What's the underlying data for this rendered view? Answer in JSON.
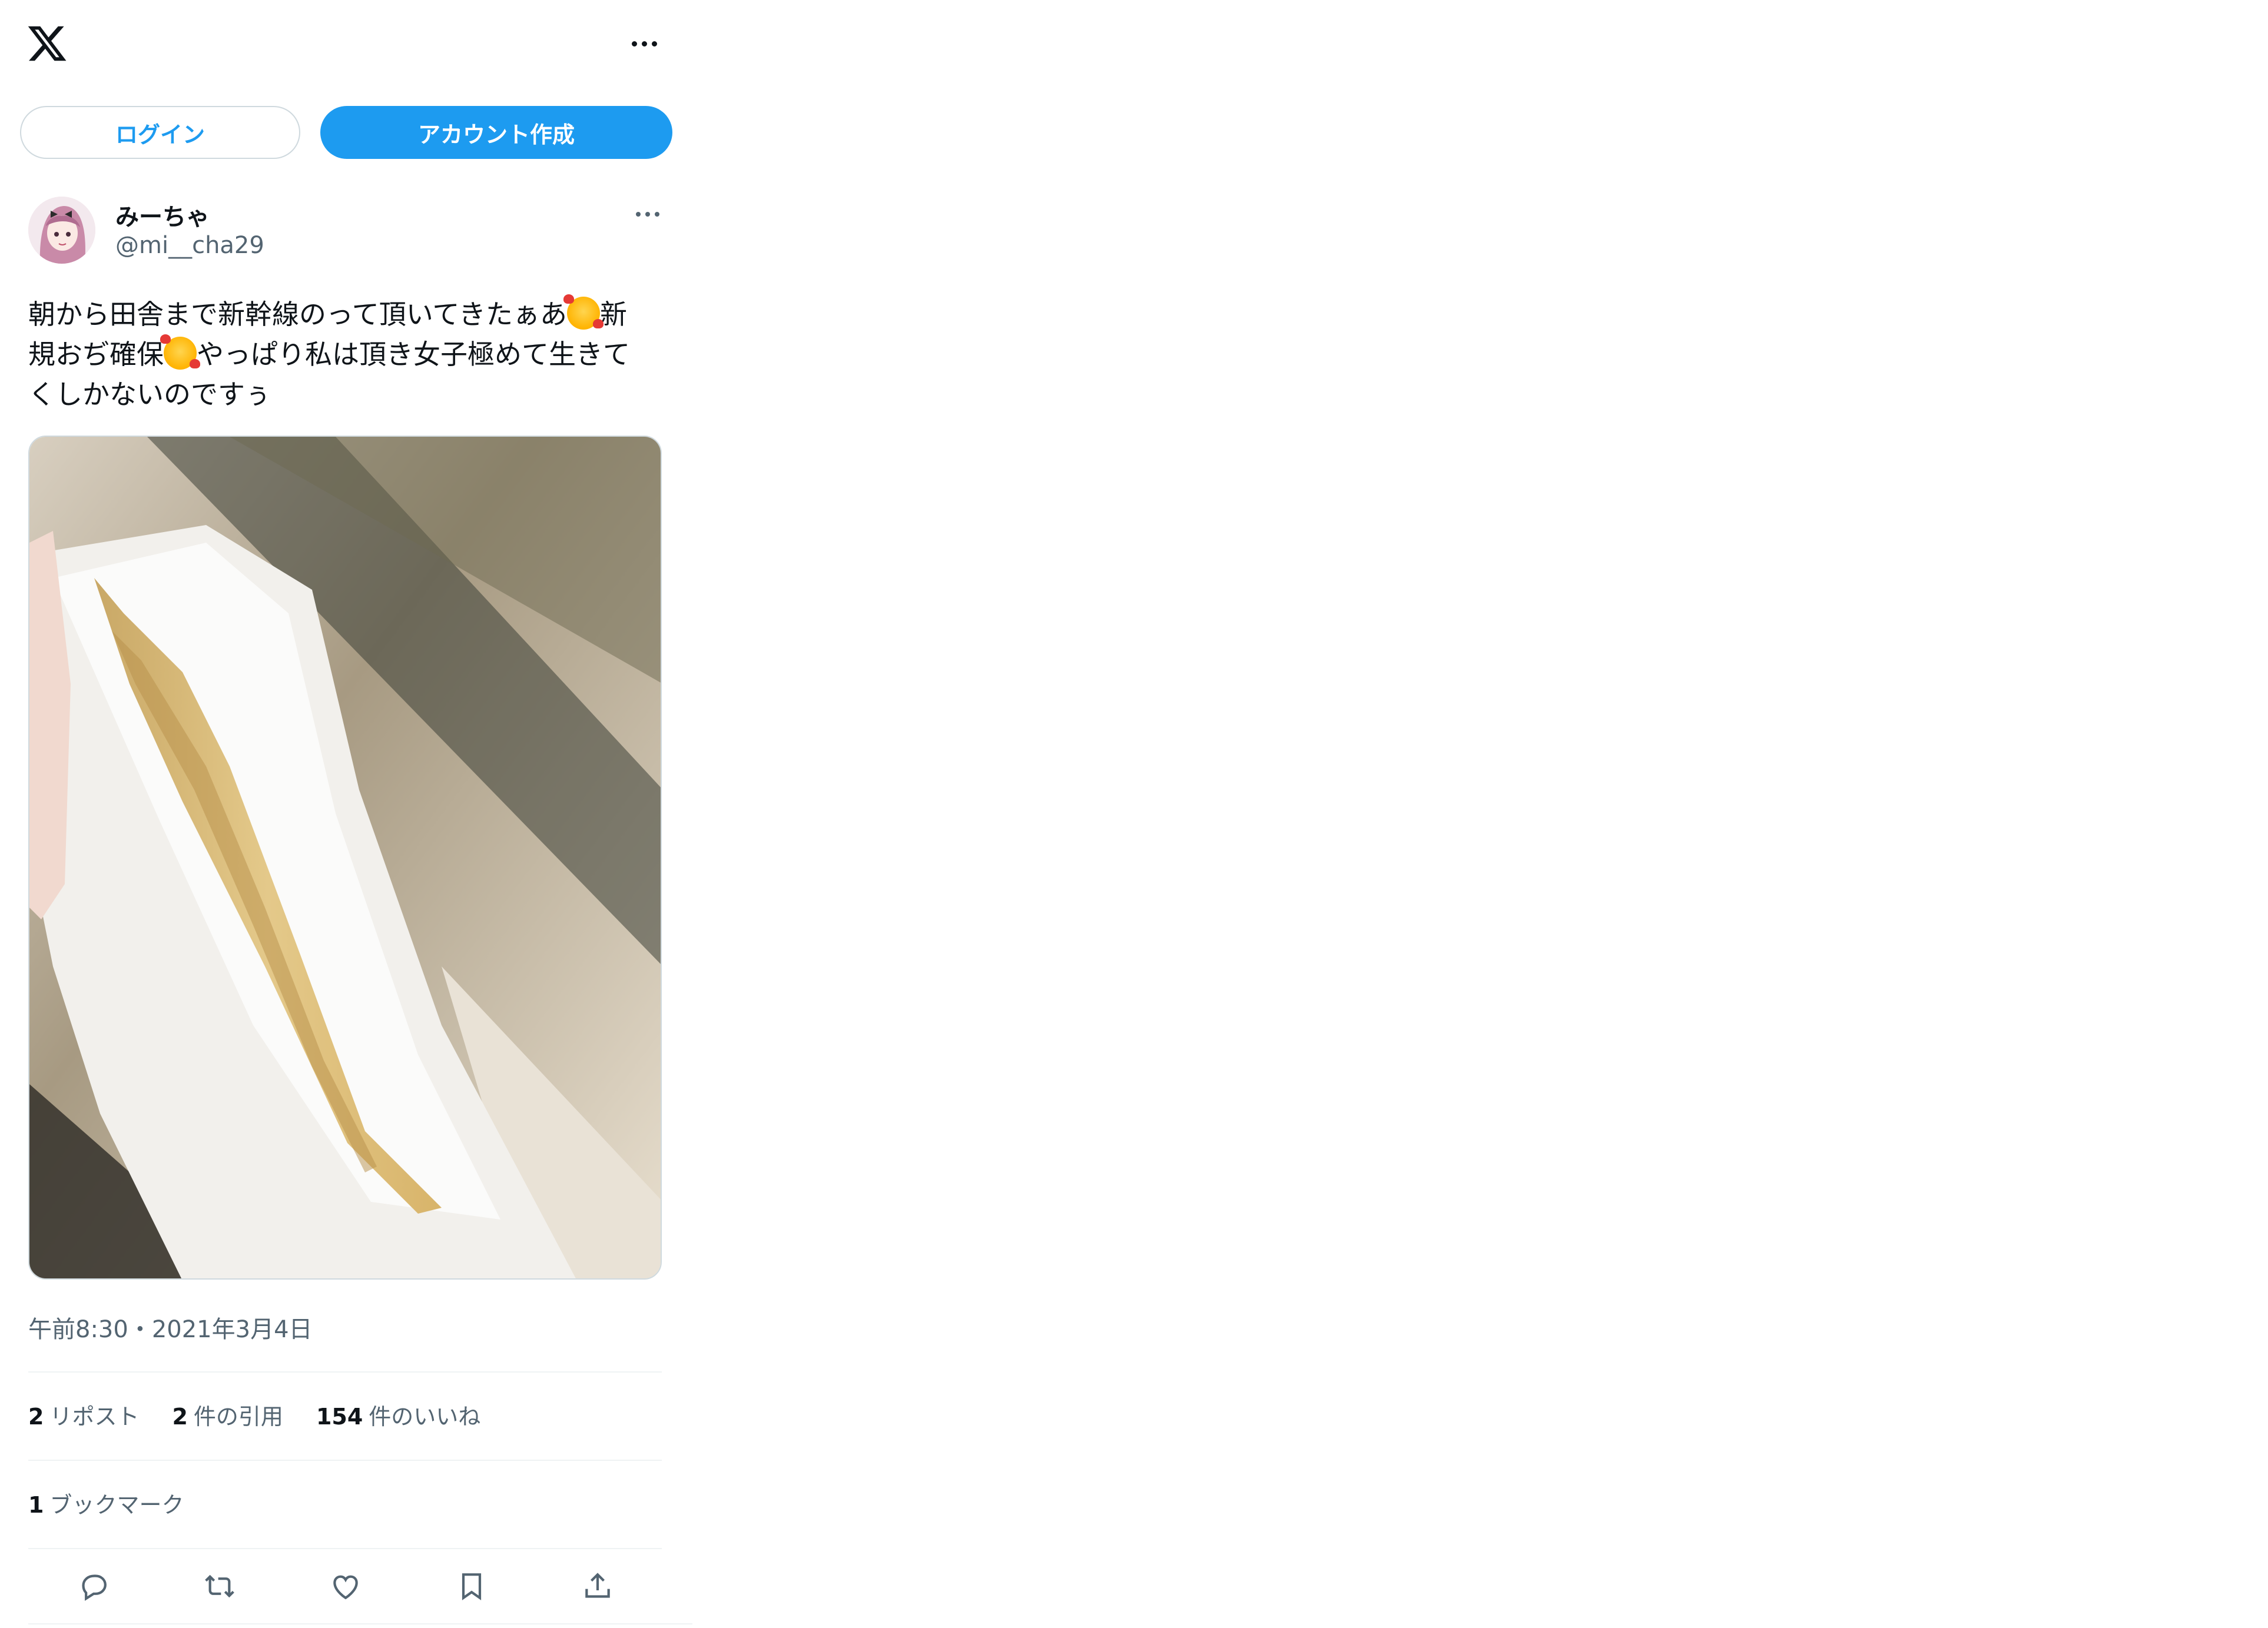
{
  "header": {
    "logo": "x-logo-icon",
    "more": "more-options-icon"
  },
  "auth": {
    "login_label": "ログイン",
    "signup_label": "アカウント作成"
  },
  "tweet": {
    "author": {
      "display_name": "みーちゃ",
      "handle": "@mi__cha29"
    },
    "text_line1": "朝から田舎まで新幹線のって頂いてきたぁあ",
    "text_line1_end": "新",
    "text_line2a": "規おぢ確保",
    "text_line2b": "やっぱり私は頂き女子極めて生きて",
    "text_line3": "くしかないのですぅ",
    "emoji": "smiling-face-with-hearts",
    "timestamp": "午前8:30・2021年3月4日",
    "stats": {
      "reposts_count": "2",
      "reposts_label": "リポスト",
      "quotes_count": "2",
      "quotes_label": "件の引用",
      "likes_count": "154",
      "likes_label": "件のいいね"
    },
    "bookmarks_count": "1",
    "bookmarks_label": "ブックマーク"
  },
  "actions": [
    "reply-icon",
    "retweet-icon",
    "like-icon",
    "bookmark-icon",
    "share-icon"
  ],
  "colors": {
    "accent": "#1d9bf0",
    "text_primary": "#0f1419",
    "text_secondary": "#536471",
    "border": "#cfd9de",
    "divider": "#eff3f4"
  }
}
